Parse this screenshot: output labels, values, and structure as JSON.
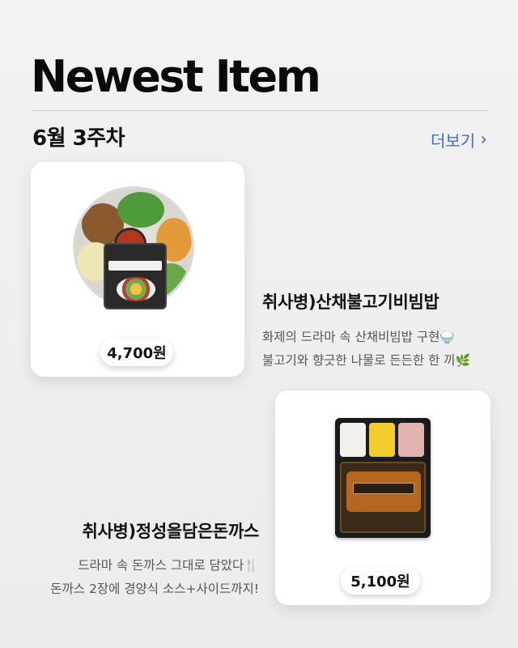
{
  "header": {
    "title": "Newest Item",
    "week": "6월 3주차",
    "more_label": "더보기",
    "more_icon": "chevron-right-icon"
  },
  "products": [
    {
      "name": "취사병)산채불고기비빔밥",
      "price": "4,700원",
      "desc_line1": "화제의 드라마 속 산채비빔밥 구현",
      "desc_line1_emoji": "🍚",
      "desc_line2": "불고기와 향긋한 나물로 든든한 한 끼",
      "desc_line2_emoji": "🌿"
    },
    {
      "name": "취사병)정성을담은돈까스",
      "price": "5,100원",
      "desc_line1": "드라마 속 돈까스 그대로 담았다",
      "desc_line1_emoji": "🍴",
      "desc_line2": "돈까스 2장에 경양식 소스+사이드까지!"
    }
  ],
  "colors": {
    "accent": "#3f6fd8",
    "background": "#efefef",
    "text": "#111111"
  }
}
